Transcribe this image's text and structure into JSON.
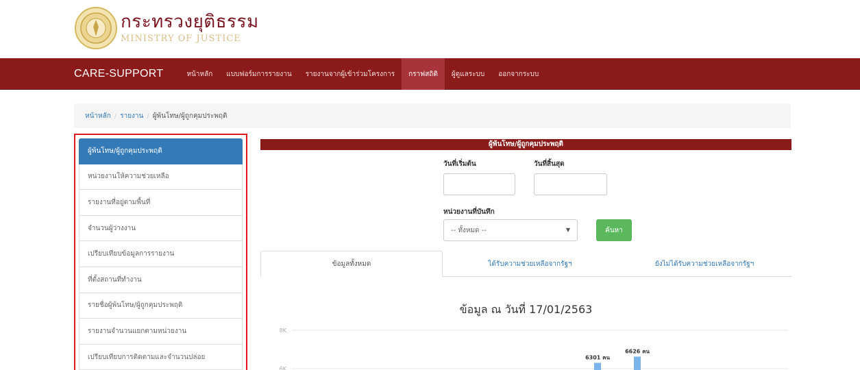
{
  "org": {
    "name_th": "กระทรวงยุติธรรม",
    "name_en": "MINISTRY OF JUSTICE"
  },
  "navbar": {
    "brand": "CARE-SUPPORT",
    "items": [
      {
        "label": "หน้าหลัก"
      },
      {
        "label": "แบบฟอร์มการรายงาน"
      },
      {
        "label": "รายงานจากผู้เข้าร่วมโครงการ"
      },
      {
        "label": "กราฟสถิติ"
      },
      {
        "label": "ผู้ดูแลระบบ"
      },
      {
        "label": "ออกจากระบบ"
      }
    ],
    "active_index": 3
  },
  "breadcrumb": {
    "home": "หน้าหลัก",
    "reports": "รายงาน",
    "current": "ผู้พ้นโทษ/ผู้ถูกคุมประพฤติ"
  },
  "sidebar": {
    "items": [
      {
        "label": "ผู้พ้นโทษ/ผู้ถูกคุมประพฤติ"
      },
      {
        "label": "หน่วยงานให้ความช่วยเหลือ"
      },
      {
        "label": "รายงานที่อยู่ตามพื้นที่"
      },
      {
        "label": "จำนวนผู้ว่างงาน"
      },
      {
        "label": "เปรียบเทียบข้อมูลการรายงาน"
      },
      {
        "label": "ที่ตั้งสถานที่ทำงาน"
      },
      {
        "label": "รายชื่อผู้พ้นโทษ/ผู้ถูกคุมประพฤติ"
      },
      {
        "label": "รายงานจำนวนแยกตามหน่วยงาน"
      },
      {
        "label": "เปรียบเทียบการติดตามและจำนวนปล่อย"
      }
    ],
    "active_index": 0
  },
  "panel": {
    "title": "ผู้พ้นโทษ/ผู้ถูกคุมประพฤติ",
    "start_date_label": "วันที่เริ่มต้น",
    "end_date_label": "วันที่สิ้นสุด",
    "start_date_value": "",
    "end_date_value": "",
    "unit_label": "หน่วยงานที่บันทึก",
    "unit_selected": "-- ทั้งหมด --",
    "search_label": "ค้นหา"
  },
  "tabs": [
    {
      "label": "ข้อมูลทั้งหมด"
    },
    {
      "label": "ได้รับความช่วยเหลือจากรัฐฯ"
    },
    {
      "label": "ยังไม่ได้รับความช่วยเหลือจากรัฐฯ"
    }
  ],
  "chart_title": "ข้อมูล ณ วันที่ 17/01/2563",
  "colors": {
    "navbar": "#8b1a1a",
    "active_side": "#337ab7",
    "search_button": "#5cb85c",
    "bar": "#7cb5ec",
    "outline": "#e0191c"
  },
  "chart_data": {
    "type": "bar",
    "yticks": [
      "8K",
      "6K"
    ],
    "ylim": [
      0,
      8000
    ],
    "series": [
      {
        "values": [
          6301,
          6626
        ],
        "labels": [
          "6301 คน",
          "6626 คน"
        ]
      }
    ]
  }
}
